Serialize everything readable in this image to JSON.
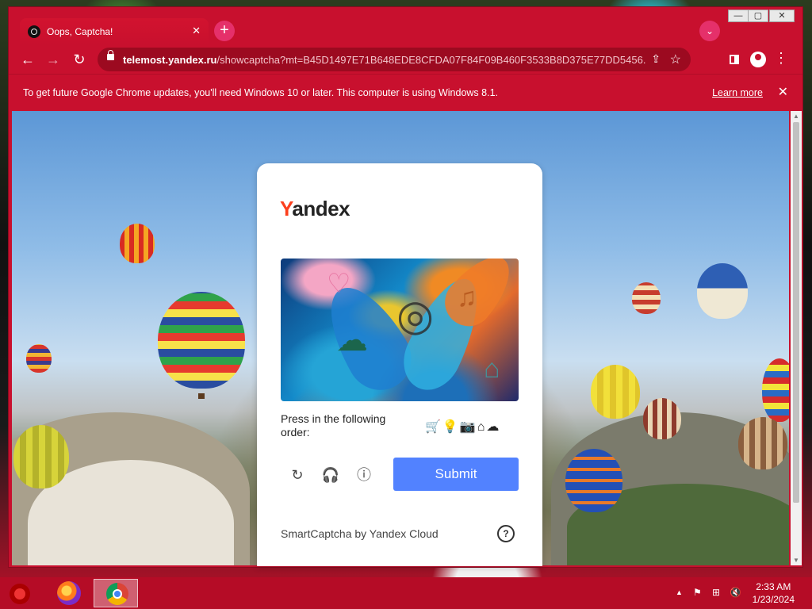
{
  "window": {
    "tab_title": "Oops, Captcha!",
    "tab_close": "✕",
    "new_tab": "+",
    "tab_search": "⌄",
    "controls": {
      "minimize": "—",
      "maximize": "▢",
      "close": "✕"
    }
  },
  "toolbar": {
    "back": "←",
    "forward": "→",
    "reload": "↻",
    "url_host": "telemost.yandex.ru",
    "url_path": "/showcaptcha?mt=B45D1497E71B648EDE8CFDA07F84F09B460F3533B8D375E77DD5456...",
    "share": "⇪",
    "star": "☆",
    "menu": "⋮"
  },
  "infobar": {
    "message": "To get future Google Chrome updates, you'll need Windows 10 or later. This computer is using Windows 8.1.",
    "learn_more": "Learn more",
    "close": "✕"
  },
  "captcha": {
    "brand_first": "Y",
    "brand_rest": "andex",
    "prompt": "Press in the following order:",
    "order_icons": [
      "cart-icon",
      "lightbulb-icon",
      "camera-icon",
      "house-icon",
      "cloud-icon"
    ],
    "order_glyphs": "🛒💡📷⌂☁",
    "refresh": "↻",
    "audio": "🎧",
    "info": "ⓘ",
    "submit": "Submit",
    "footer": "SmartCaptcha by Yandex Cloud",
    "help": "?"
  },
  "taskbar": {
    "clock_time": "2:33 AM",
    "clock_date": "1/23/2024",
    "tray_up": "▲",
    "tray_flag": "⚑",
    "tray_network": "⊞",
    "tray_volume": "🔇"
  },
  "colors": {
    "chrome_theme": "#c8102e",
    "submit": "#5282ff",
    "yandex_red": "#fc3f1d"
  }
}
